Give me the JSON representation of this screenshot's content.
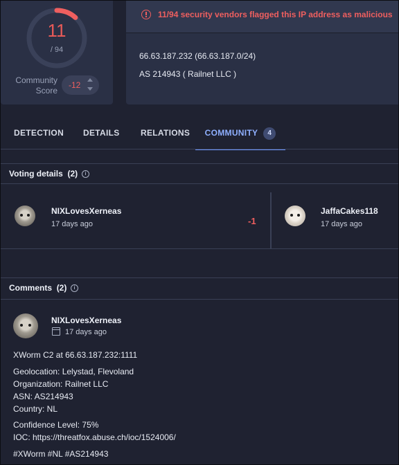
{
  "summary": {
    "detections": "11",
    "total": "/ 94",
    "detection_fraction": 0.117,
    "community_label_line1": "Community",
    "community_label_line2": "Score",
    "community_score": "-12",
    "alert_text": "11/94 security vendors flagged this IP address as malicious",
    "ip_line": "66.63.187.232  (66.63.187.0/24)",
    "as_line": "AS 214943   ( Railnet LLC )"
  },
  "tabs": [
    {
      "label": "DETECTION"
    },
    {
      "label": "DETAILS"
    },
    {
      "label": "RELATIONS"
    },
    {
      "label": "COMMUNITY",
      "badge": "4"
    }
  ],
  "voting": {
    "title": "Voting details",
    "count": "(2)",
    "votes": [
      {
        "user": "NIXLovesXerneas",
        "date": "17 days ago",
        "value": "-1"
      },
      {
        "user": "JaffaCakes118",
        "date": "17 days ago"
      }
    ]
  },
  "comments": {
    "title": "Comments",
    "count": "(2)",
    "items": [
      {
        "user": "NIXLovesXerneas",
        "date": "17 days ago",
        "lines": [
          "XWorm C2 at 66.63.187.232:1111",
          "Geolocation: Lelystad, Flevoland",
          "Organization: Railnet LLC",
          "ASN: AS214943",
          "Country: NL",
          "Confidence Level: 75%",
          "IOC: https://threatfox.abuse.ch/ioc/1524006/",
          "#XWorm #NL #AS214943"
        ]
      }
    ]
  },
  "colors": {
    "background": "#1f2231",
    "card": "#2a3045",
    "malicious": "#ef5f5f",
    "accent": "#6f98ff"
  },
  "icons": {
    "alert": "alert-circle-icon",
    "info": "info-icon",
    "calendar": "calendar-icon",
    "vote_up": "chevron-up-icon",
    "vote_down": "chevron-down-icon"
  }
}
